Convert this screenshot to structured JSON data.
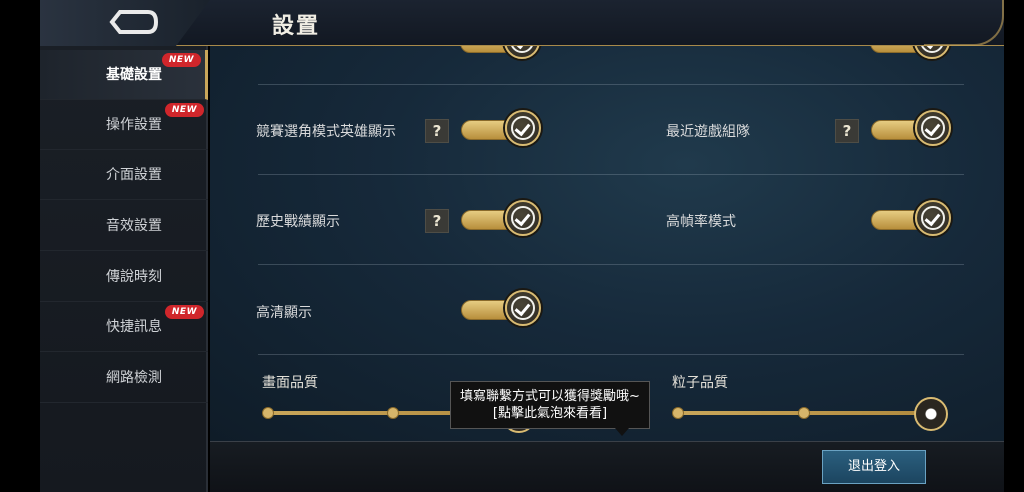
{
  "header": {
    "title": "設置"
  },
  "sidebar": {
    "items": [
      {
        "label": "基礎設置",
        "active": true,
        "badge": "NEW"
      },
      {
        "label": "操作設置",
        "active": false,
        "badge": "NEW"
      },
      {
        "label": "介面設置",
        "active": false,
        "badge": ""
      },
      {
        "label": "音效設置",
        "active": false,
        "badge": ""
      },
      {
        "label": "傳說時刻",
        "active": false,
        "badge": ""
      },
      {
        "label": "快捷訊息",
        "active": false,
        "badge": "NEW"
      },
      {
        "label": "網路檢測",
        "active": false,
        "badge": ""
      }
    ]
  },
  "settings": {
    "hero_display": {
      "label": "競賽選角模式英雄顯示",
      "help": "?",
      "on": true
    },
    "recent_team": {
      "label": "最近遊戲組隊",
      "help": "?",
      "on": true
    },
    "history_display": {
      "label": "歷史戰績顯示",
      "help": "?",
      "on": true
    },
    "high_fps": {
      "label": "高幀率模式",
      "on": true
    },
    "hd_display": {
      "label": "高清顯示",
      "on": true
    }
  },
  "quality": {
    "graphics": {
      "label": "畫面品質"
    },
    "particles": {
      "label": "粒子品質"
    }
  },
  "tooltip": {
    "line1": "填寫聯繫方式可以獲得獎勵哦~",
    "line2": "[點擊此氣泡來看看]"
  },
  "footer": {
    "logout_label": "退出登入"
  },
  "colors": {
    "accent_gold": "#c9a65a",
    "badge_red": "#d0262b",
    "logout_blue": "#2b5f7e"
  }
}
